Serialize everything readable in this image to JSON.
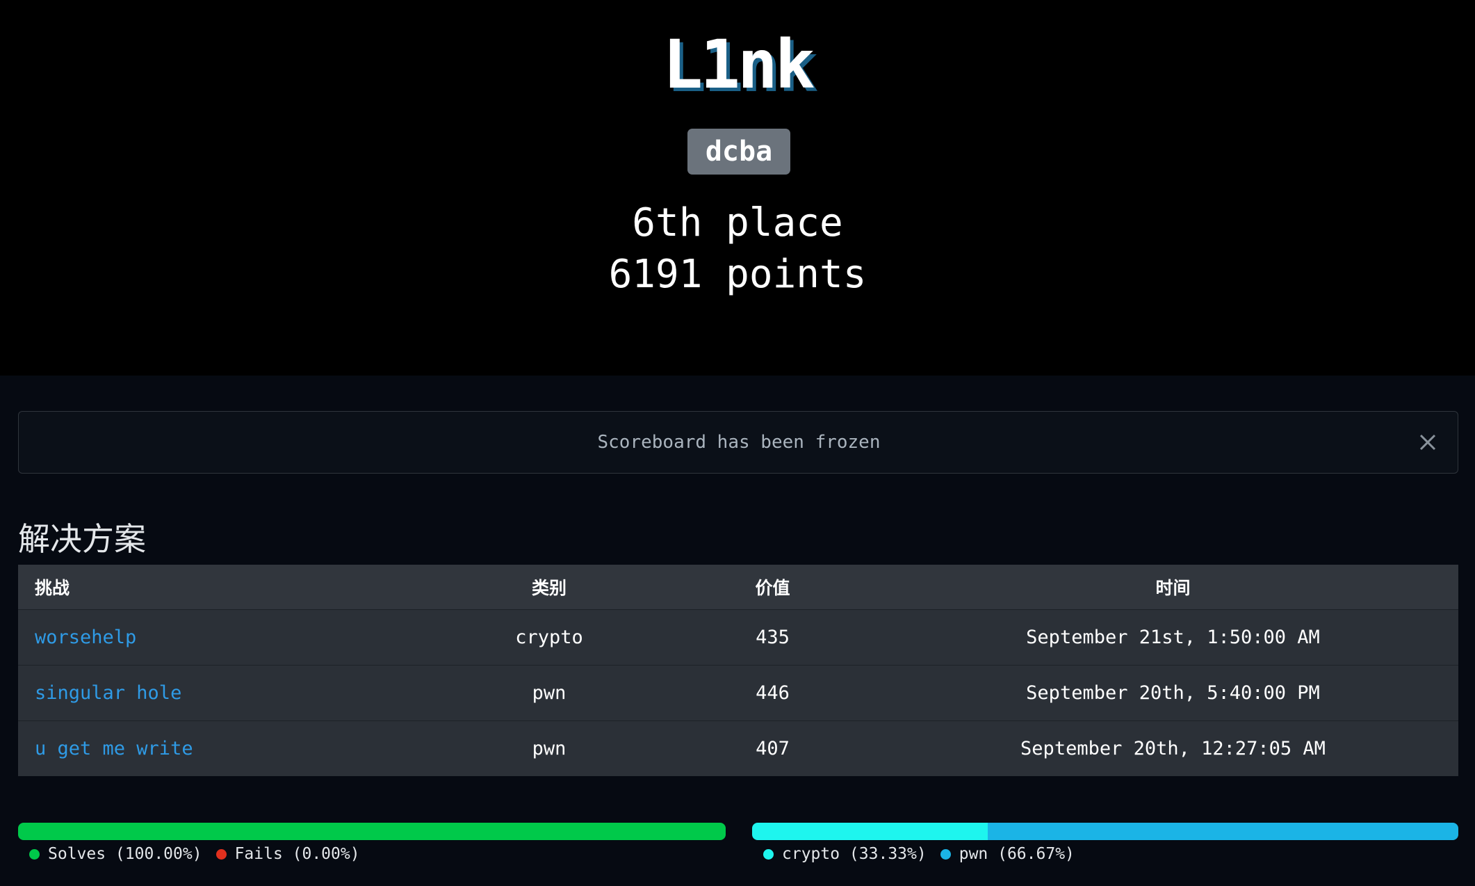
{
  "team": {
    "name": "L1nk",
    "affiliation": "dcba",
    "place": "6th place",
    "points": "6191 points"
  },
  "alert": {
    "message": "Scoreboard has been frozen"
  },
  "solves": {
    "title": "解决方案",
    "columns": [
      "挑战",
      "类别",
      "价值",
      "时间"
    ],
    "rows": [
      {
        "challenge": "worsehelp",
        "category": "crypto",
        "value": "435",
        "time": "September 21st, 1:50:00 AM"
      },
      {
        "challenge": "singular hole",
        "category": "pwn",
        "value": "446",
        "time": "September 20th, 5:40:00 PM"
      },
      {
        "challenge": "u get me write",
        "category": "pwn",
        "value": "407",
        "time": "September 20th, 12:27:05 AM"
      }
    ]
  },
  "chart_data": [
    {
      "type": "bar",
      "categories": [
        "Solves",
        "Fails"
      ],
      "values": [
        100.0,
        0.0
      ],
      "legend": [
        "Solves (100.00%)",
        "Fails (0.00%)"
      ],
      "colors": [
        "#00c94a",
        "#e0301e"
      ]
    },
    {
      "type": "bar",
      "categories": [
        "crypto",
        "pwn"
      ],
      "values": [
        33.33,
        66.67
      ],
      "legend": [
        "crypto (33.33%)",
        "pwn (66.67%)"
      ],
      "colors": [
        "#1ef5ee",
        "#1bb4e6"
      ]
    }
  ],
  "colors": {
    "hero_bg": "#000000",
    "page_bg": "#060a12",
    "link": "#2f9be6",
    "badge": "#6b737c"
  }
}
